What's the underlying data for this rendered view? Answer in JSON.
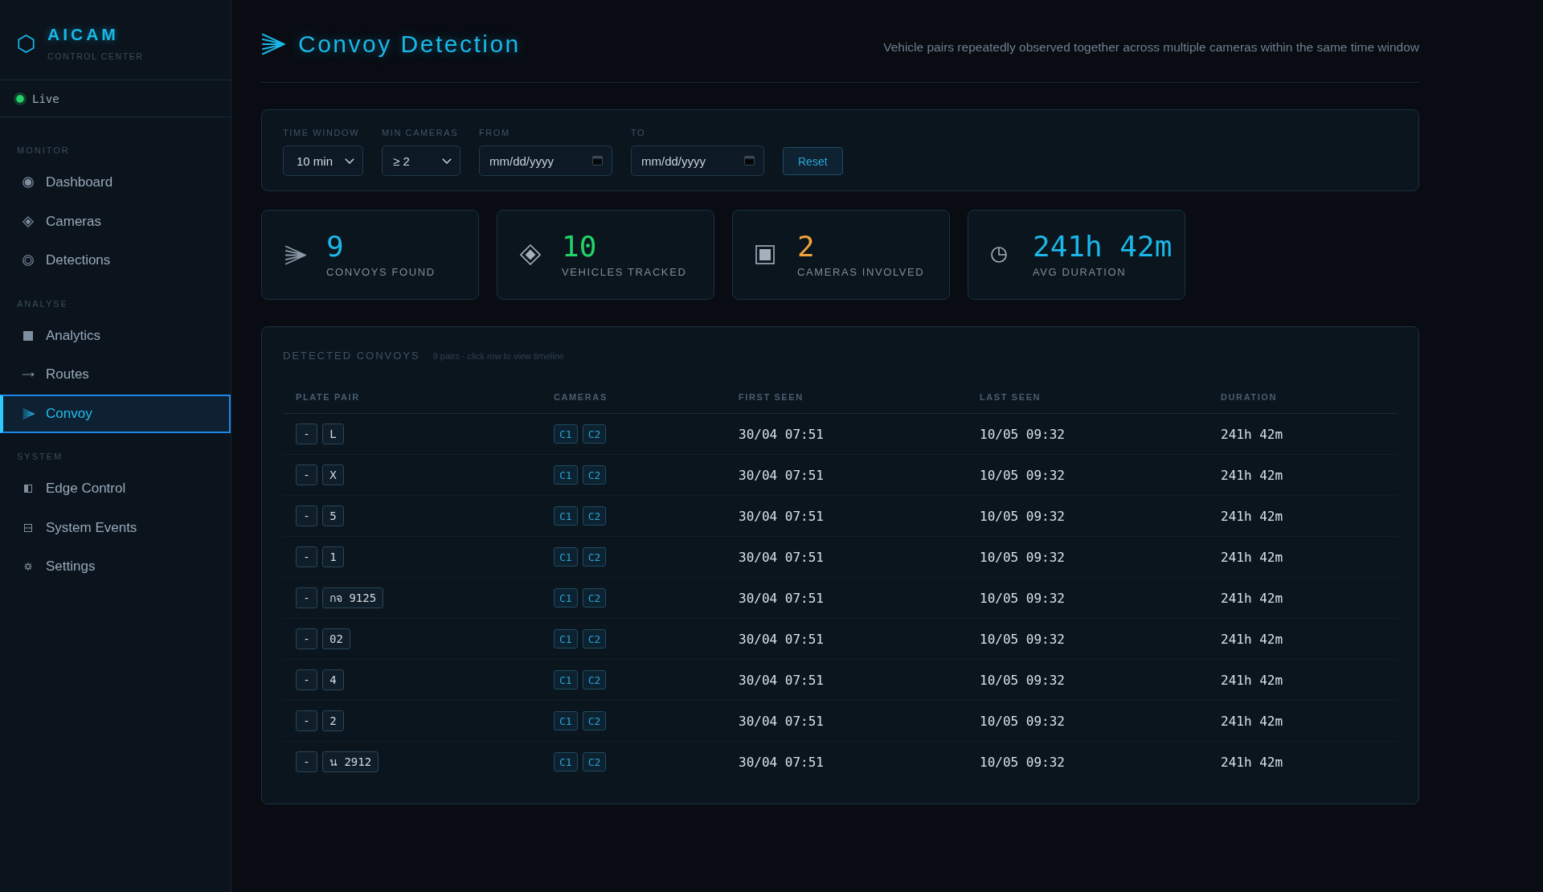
{
  "sidebar": {
    "brand": {
      "name": "AICAM",
      "subtitle": "CONTROL CENTER"
    },
    "status": {
      "label": "Live",
      "online": true
    },
    "sections": [
      {
        "title": "MONITOR",
        "items": [
          {
            "label": "Dashboard",
            "selected": false
          },
          {
            "label": "Cameras",
            "selected": false
          },
          {
            "label": "Detections",
            "selected": false
          }
        ]
      },
      {
        "title": "ANALYSE",
        "items": [
          {
            "label": "Analytics",
            "selected": false
          },
          {
            "label": "Routes",
            "selected": false
          },
          {
            "label": "Convoy",
            "selected": true
          }
        ]
      },
      {
        "title": "SYSTEM",
        "items": [
          {
            "label": "Edge Control",
            "selected": false
          },
          {
            "label": "System Events",
            "selected": false
          },
          {
            "label": "Settings",
            "selected": false
          }
        ]
      }
    ]
  },
  "header": {
    "title": "Convoy Detection",
    "subtitle": "Vehicle pairs repeatedly observed together across multiple cameras within the same time window"
  },
  "filters": {
    "fields": [
      {
        "kind": "select",
        "label": "TIME WINDOW",
        "value": "10 min"
      },
      {
        "kind": "select",
        "label": "MIN CAMERAS",
        "value": "≥ 2"
      },
      {
        "kind": "date",
        "label": "FROM",
        "placeholder": "mm/dd/yyyy"
      },
      {
        "kind": "date",
        "label": "TO",
        "placeholder": "mm/dd/yyyy"
      }
    ],
    "reset_button": "Reset"
  },
  "stats": [
    {
      "value": "9",
      "label": "CONVOYS FOUND",
      "color": "#1ab8e8"
    },
    {
      "value": "10",
      "label": "VEHICLES TRACKED",
      "color": "#22d36a"
    },
    {
      "value": "2",
      "label": "CAMERAS INVOLVED",
      "color": "#f2a33a"
    },
    {
      "value": "241h 42m",
      "label": "AVG DURATION",
      "color": "#1ab8e8"
    }
  ],
  "table": {
    "title": "DETECTED CONVOYS",
    "note": "9 pairs · click row to view timeline",
    "columns": [
      "PLATE PAIR",
      "CAMERAS",
      "FIRST SEEN",
      "LAST SEEN",
      "DURATION"
    ],
    "rows": [
      {
        "plates": [
          "-",
          "L"
        ],
        "cameras": [
          "C1",
          "C2"
        ],
        "first_seen": "30/04 07:51",
        "last_seen": "10/05 09:32",
        "duration": "241h 42m"
      },
      {
        "plates": [
          "-",
          "X"
        ],
        "cameras": [
          "C1",
          "C2"
        ],
        "first_seen": "30/04 07:51",
        "last_seen": "10/05 09:32",
        "duration": "241h 42m"
      },
      {
        "plates": [
          "-",
          "5"
        ],
        "cameras": [
          "C1",
          "C2"
        ],
        "first_seen": "30/04 07:51",
        "last_seen": "10/05 09:32",
        "duration": "241h 42m"
      },
      {
        "plates": [
          "-",
          "1"
        ],
        "cameras": [
          "C1",
          "C2"
        ],
        "first_seen": "30/04 07:51",
        "last_seen": "10/05 09:32",
        "duration": "241h 42m"
      },
      {
        "plates": [
          "-",
          "กจ 9125"
        ],
        "cameras": [
          "C1",
          "C2"
        ],
        "first_seen": "30/04 07:51",
        "last_seen": "10/05 09:32",
        "duration": "241h 42m"
      },
      {
        "plates": [
          "-",
          "02"
        ],
        "cameras": [
          "C1",
          "C2"
        ],
        "first_seen": "30/04 07:51",
        "last_seen": "10/05 09:32",
        "duration": "241h 42m"
      },
      {
        "plates": [
          "-",
          "4"
        ],
        "cameras": [
          "C1",
          "C2"
        ],
        "first_seen": "30/04 07:51",
        "last_seen": "10/05 09:32",
        "duration": "241h 42m"
      },
      {
        "plates": [
          "-",
          "2"
        ],
        "cameras": [
          "C1",
          "C2"
        ],
        "first_seen": "30/04 07:51",
        "last_seen": "10/05 09:32",
        "duration": "241h 42m"
      },
      {
        "plates": [
          "-",
          "น 2912"
        ],
        "cameras": [
          "C1",
          "C2"
        ],
        "first_seen": "30/04 07:51",
        "last_seen": "10/05 09:32",
        "duration": "241h 42m"
      }
    ]
  }
}
